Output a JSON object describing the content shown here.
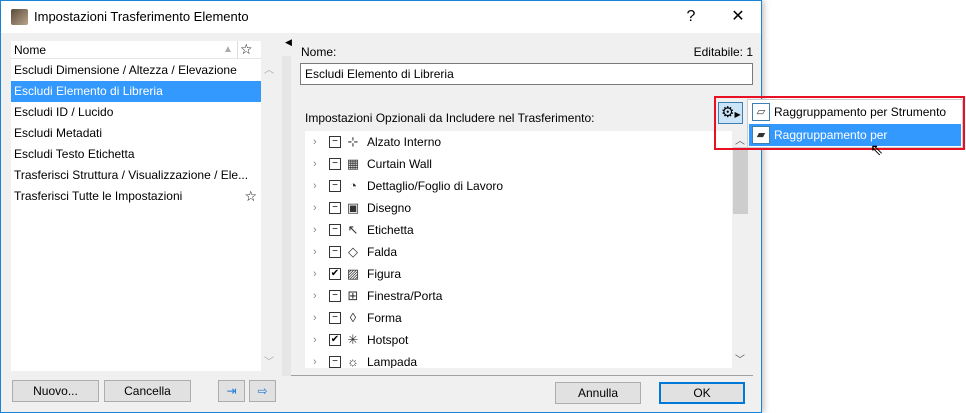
{
  "window": {
    "title": "Impostazioni Trasferimento Elemento",
    "help": "?",
    "close": "✕"
  },
  "left": {
    "header": "Nome",
    "items": [
      {
        "label": "Escludi Dimensione / Altezza / Elevazione",
        "fav": false
      },
      {
        "label": "Escludi Elemento di Libreria",
        "fav": false,
        "selected": true
      },
      {
        "label": "Escludi ID / Lucido",
        "fav": false
      },
      {
        "label": "Escludi Metadati",
        "fav": false
      },
      {
        "label": "Escludi Testo Etichetta",
        "fav": false
      },
      {
        "label": "Trasferisci Struttura / Visualizzazione / Ele...",
        "fav": false
      },
      {
        "label": "Trasferisci Tutte le Impostazioni",
        "fav": true
      }
    ],
    "new_button": "Nuovo...",
    "delete_button": "Cancella"
  },
  "right": {
    "name_label": "Nome:",
    "editable": "Editabile: 1",
    "name_value": "Escludi Elemento di Libreria",
    "options_label": "Impostazioni Opzionali da Includere nel Trasferimento:",
    "tree": [
      {
        "label": "Alzato Interno",
        "checked": "partial",
        "icon": "⊹"
      },
      {
        "label": "Curtain Wall",
        "checked": "partial",
        "icon": "▦"
      },
      {
        "label": "Dettaglio/Foglio di Lavoro",
        "checked": "partial",
        "icon": "◔"
      },
      {
        "label": "Disegno",
        "checked": "partial",
        "icon": "▣"
      },
      {
        "label": "Etichetta",
        "checked": "partial",
        "icon": "↖"
      },
      {
        "label": "Falda",
        "checked": "partial",
        "icon": "◇"
      },
      {
        "label": "Figura",
        "checked": "checked",
        "icon": "▨"
      },
      {
        "label": "Finestra/Porta",
        "checked": "partial",
        "icon": "⊞"
      },
      {
        "label": "Forma",
        "checked": "partial",
        "icon": "◊"
      },
      {
        "label": "Hotspot",
        "checked": "checked",
        "icon": "✳"
      },
      {
        "label": "Lampada",
        "checked": "partial",
        "icon": "☼"
      }
    ],
    "cancel_button": "Annulla",
    "ok_button": "OK"
  },
  "menu": {
    "items": [
      {
        "label": "Raggruppamento per Strumento",
        "selected": false
      },
      {
        "label": "Raggruppamento per Impostazione",
        "selected": true
      }
    ]
  }
}
